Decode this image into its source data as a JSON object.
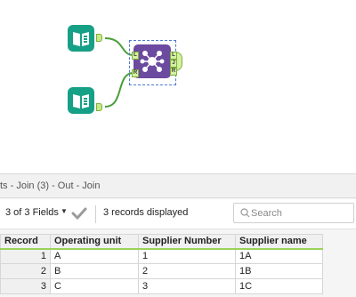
{
  "canvas": {
    "tools": [
      {
        "name": "input-data-1",
        "icon": "book-icon"
      },
      {
        "name": "input-data-2",
        "icon": "book-icon"
      },
      {
        "name": "join-tool",
        "icon": "join-icon",
        "anchors": {
          "left": "L",
          "right": "R",
          "outputs": [
            "L",
            "J",
            "R"
          ]
        }
      }
    ],
    "colors": {
      "input_tool": "#16a086",
      "join_tool": "#6b4aa0",
      "connection": "#4a9e3a"
    }
  },
  "results": {
    "title": "ts - Join (3) - Out - Join",
    "fields_selector": "3 of 3 Fields",
    "records_displayed": "3 records displayed",
    "search_placeholder": "Search",
    "columns": [
      "Record",
      "Operating unit",
      "Supplier Number",
      "Supplier name"
    ],
    "rows": [
      {
        "record": "1",
        "operating_unit": "A",
        "supplier_number": "1",
        "supplier_name": "1A"
      },
      {
        "record": "2",
        "operating_unit": "B",
        "supplier_number": "2",
        "supplier_name": "1B"
      },
      {
        "record": "3",
        "operating_unit": "C",
        "supplier_number": "3",
        "supplier_name": "1C"
      }
    ]
  }
}
